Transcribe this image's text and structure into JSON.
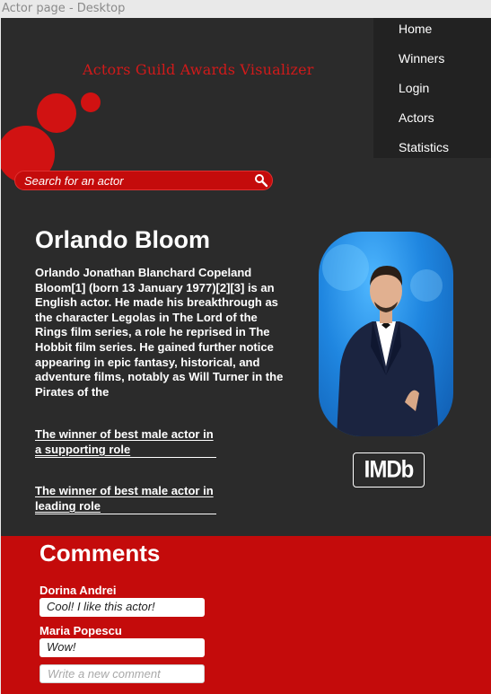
{
  "window": {
    "title": "Actor page - Desktop"
  },
  "header": {
    "site_title": "Actors Guild Awards Visualizer"
  },
  "nav": {
    "items": [
      "Home",
      "Winners",
      "Login",
      "Actors",
      "Statistics"
    ]
  },
  "search": {
    "placeholder": "Search for an actor"
  },
  "actor": {
    "name": "Orlando Bloom",
    "bio": "Orlando Jonathan Blanchard Copeland Bloom[1] (born 13 January 1977)[2][3] is an English actor. He made his breakthrough as the character Legolas in The Lord of the Rings film series, a role he reprised in The Hobbit film series. He gained further notice appearing in epic fantasy, historical, and adventure films, notably as Will Turner in the Pirates of the",
    "awards": [
      "The winner of best male actor in a supporting role",
      "The winner of best male actor in leading role"
    ],
    "imdb_label": "IMDb"
  },
  "comments": {
    "title": "Comments",
    "items": [
      {
        "author": "Dorina Andrei",
        "text": "Cool! I like this actor!"
      },
      {
        "author": "Maria Popescu",
        "text": "Wow!"
      }
    ],
    "new_placeholder": "Write a new comment"
  },
  "colors": {
    "accent_red": "#c40b0b",
    "background": "#2b2b2b",
    "nav_background": "#222222"
  }
}
